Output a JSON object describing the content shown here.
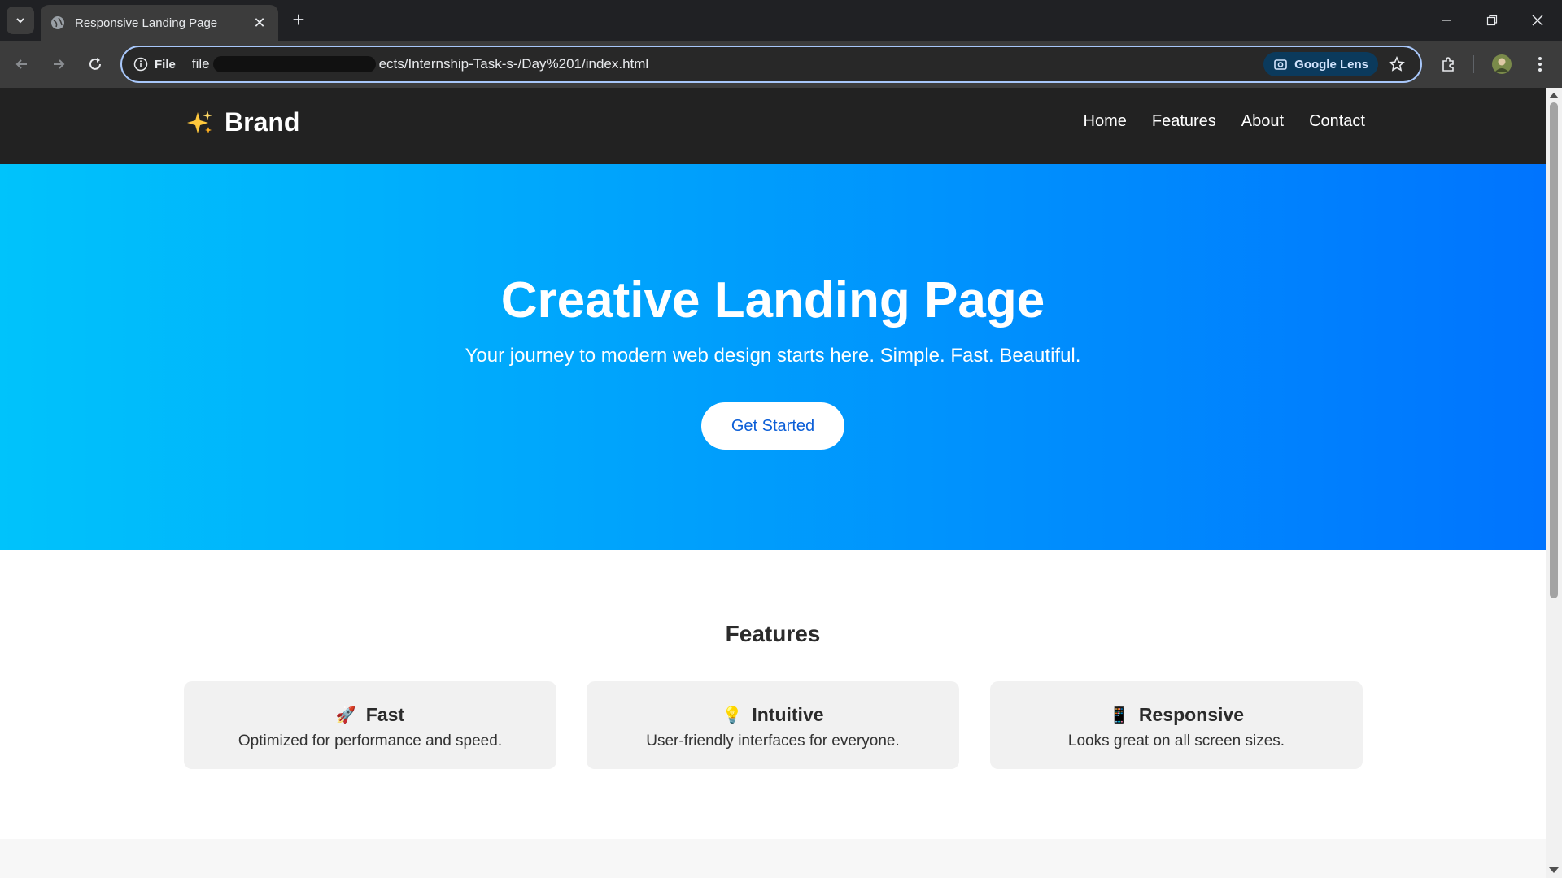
{
  "browser": {
    "tab_title": "Responsive Landing Page",
    "omnibox": {
      "scheme_chip": "File",
      "url_start": "file",
      "url_end": "ects/Internship-Task-s-/Day%201/index.html",
      "lens_label": "Google Lens"
    }
  },
  "site": {
    "brand": "Brand",
    "brand_icon": "sparkles-icon",
    "nav": [
      "Home",
      "Features",
      "About",
      "Contact"
    ],
    "hero": {
      "title": "Creative Landing Page",
      "subtitle": "Your journey to modern web design starts here. Simple. Fast. Beautiful.",
      "cta": "Get Started",
      "gradient_start": "#00c3fb",
      "gradient_end": "#0074fe"
    },
    "features": {
      "heading": "Features",
      "cards": [
        {
          "emoji": "🚀",
          "icon": "rocket-icon",
          "title": "Fast",
          "desc": "Optimized for performance and speed."
        },
        {
          "emoji": "💡",
          "icon": "lightbulb-icon",
          "title": "Intuitive",
          "desc": "User-friendly interfaces for everyone."
        },
        {
          "emoji": "📱",
          "icon": "mobile-icon",
          "title": "Responsive",
          "desc": "Looks great on all screen sizes."
        }
      ]
    }
  }
}
